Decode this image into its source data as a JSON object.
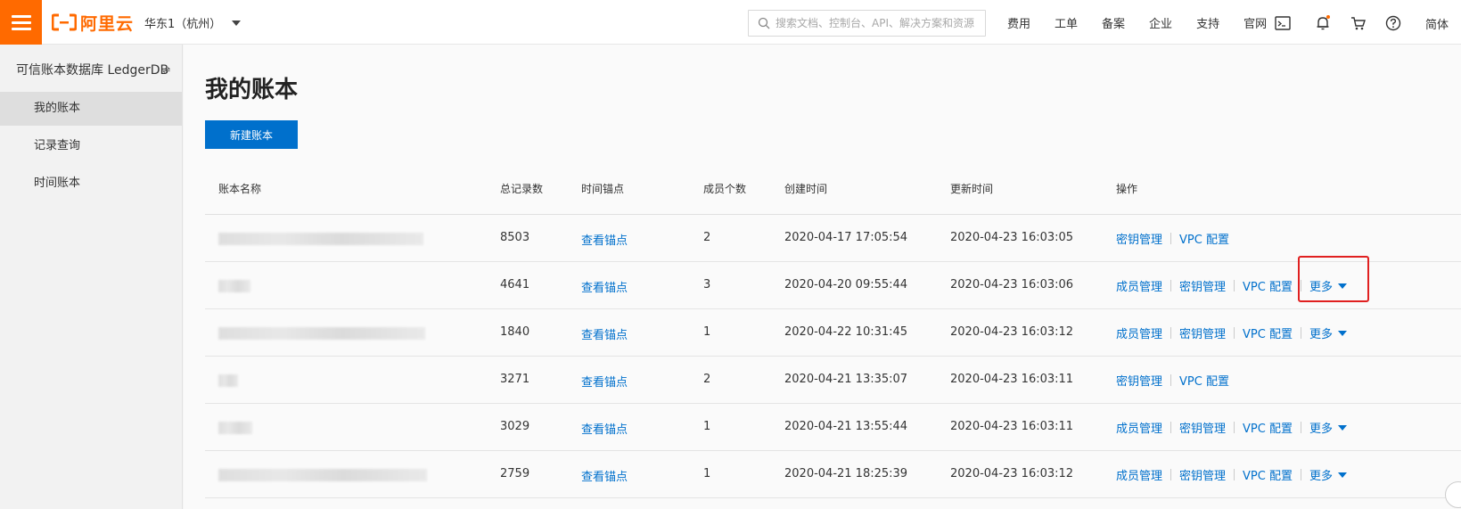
{
  "topbar": {
    "logo_text": "阿里云",
    "region": "华东1（杭州）",
    "search_placeholder": "搜索文档、控制台、API、解决方案和资源",
    "nav": [
      "费用",
      "工单",
      "备案",
      "企业",
      "支持",
      "官网"
    ],
    "lang": "简体",
    "icons": [
      "terminal-icon",
      "bell-icon",
      "cart-icon",
      "help-icon"
    ],
    "brand_color": "#ff6a00"
  },
  "sidebar": {
    "title": "可信账本数据库 LedgerDB",
    "items": [
      {
        "label": "我的账本",
        "active": true
      },
      {
        "label": "记录查询",
        "active": false
      },
      {
        "label": "时间账本",
        "active": false
      }
    ]
  },
  "main": {
    "title": "我的账本",
    "new_button": "新建账本",
    "columns": [
      "账本名称",
      "总记录数",
      "时间锚点",
      "成员个数",
      "创建时间",
      "更新时间",
      "操作"
    ],
    "rows": [
      {
        "records": "8503",
        "anchor": "查看锚点",
        "members": "2",
        "created": "2020-04-17 17:05:54",
        "updated": "2020-04-23 16:03:05",
        "ops": [
          "密钥管理",
          "VPC 配置"
        ],
        "more": ""
      },
      {
        "records": "4641",
        "anchor": "查看锚点",
        "members": "3",
        "created": "2020-04-20 09:55:44",
        "updated": "2020-04-23 16:03:06",
        "ops": [
          "成员管理",
          "密钥管理",
          "VPC 配置"
        ],
        "more": "更多"
      },
      {
        "records": "1840",
        "anchor": "查看锚点",
        "members": "1",
        "created": "2020-04-22 10:31:45",
        "updated": "2020-04-23 16:03:12",
        "ops": [
          "成员管理",
          "密钥管理",
          "VPC 配置"
        ],
        "more": "更多"
      },
      {
        "records": "3271",
        "anchor": "查看锚点",
        "members": "2",
        "created": "2020-04-21 13:35:07",
        "updated": "2020-04-23 16:03:11",
        "ops": [
          "密钥管理",
          "VPC 配置"
        ],
        "more": ""
      },
      {
        "records": "3029",
        "anchor": "查看锚点",
        "members": "1",
        "created": "2020-04-21 13:55:44",
        "updated": "2020-04-23 16:03:11",
        "ops": [
          "成员管理",
          "密钥管理",
          "VPC 配置"
        ],
        "more": "更多"
      },
      {
        "records": "2759",
        "anchor": "查看锚点",
        "members": "1",
        "created": "2020-04-21 18:25:39",
        "updated": "2020-04-23 16:03:12",
        "ops": [
          "成员管理",
          "密钥管理",
          "VPC 配置"
        ],
        "more": "更多"
      }
    ],
    "link_color": "#0070cc",
    "highlight_color": "#e02020"
  }
}
